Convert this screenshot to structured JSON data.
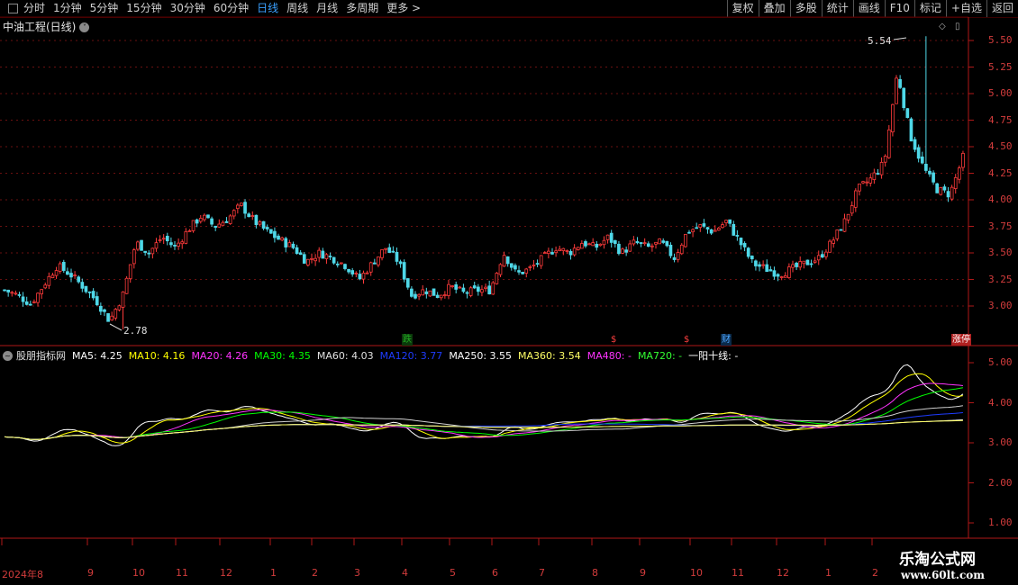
{
  "toolbar": {
    "periods": [
      "分时",
      "1分钟",
      "5分钟",
      "15分钟",
      "30分钟",
      "60分钟",
      "日线",
      "周线",
      "月线",
      "多周期",
      "更多 >"
    ],
    "active": "日线",
    "right_buttons": [
      "复权",
      "叠加",
      "多股",
      "统计",
      "画线",
      "F10",
      "标记",
      "+自选",
      "返回"
    ]
  },
  "main": {
    "title": "中油工程(日线)",
    "price_labels": [
      "5.50",
      "5.25",
      "5.00",
      "4.75",
      "4.50",
      "4.25",
      "4.00",
      "3.75",
      "3.50",
      "3.25",
      "3.00"
    ],
    "high_label": "5.54",
    "low_label": "2.78",
    "events": [
      {
        "text": "跌",
        "color": "#22aa22",
        "bg": "#0b3a0b"
      },
      {
        "text": "$",
        "color": "#ff4040",
        "bg": ""
      },
      {
        "text": "$",
        "color": "#ff4040",
        "bg": ""
      },
      {
        "text": "财",
        "color": "#4da6ff",
        "bg": "#0a2a4a"
      },
      {
        "text": "涨停",
        "color": "#ffffff",
        "bg": "#b02020"
      }
    ]
  },
  "indicator": {
    "circle": "~",
    "name": "股朋指标网",
    "items": [
      {
        "text": "MA5: 4.25",
        "color": "#ffffff"
      },
      {
        "text": "MA10: 4.16",
        "color": "#ffff00"
      },
      {
        "text": "MA20: 4.26",
        "color": "#ff33ff"
      },
      {
        "text": "MA30: 4.35",
        "color": "#00ff00"
      },
      {
        "text": "MA60: 4.03",
        "color": "#e0e0e0"
      },
      {
        "text": "MA120: 3.77",
        "color": "#1e3cff"
      },
      {
        "text": "MA250: 3.55",
        "color": "#ffffff"
      },
      {
        "text": "MA360: 3.54",
        "color": "#ffff66"
      },
      {
        "text": "MA480: -",
        "color": "#ff33ff"
      },
      {
        "text": "MA720: -",
        "color": "#33ff33"
      },
      {
        "text": "一阳十线: -",
        "color": "#ffffff"
      }
    ],
    "labels": [
      "5.00",
      "4.00",
      "3.00",
      "2.00",
      "1.00"
    ]
  },
  "x_axis": [
    "2024年8",
    "9",
    "10",
    "11",
    "12",
    "1",
    "2",
    "3",
    "4",
    "5",
    "6",
    "7",
    "8",
    "9",
    "10",
    "11",
    "12",
    "1",
    "2"
  ],
  "watermark": {
    "title": "乐淘公式网",
    "url": "www.60lt.com"
  },
  "chart_data": {
    "type": "candlestick",
    "title": "中油工程(日线)",
    "price_axis": [
      3.0,
      5.5
    ],
    "x_labels": [
      "2024年8",
      "9",
      "10",
      "11",
      "12",
      "1",
      "2",
      "3",
      "4",
      "5",
      "6",
      "7",
      "8",
      "9",
      "10",
      "11",
      "12",
      "1",
      "2"
    ],
    "high": 5.54,
    "low": 2.78,
    "anchor_closes": [
      3.15,
      3.1,
      3.02,
      3.2,
      3.38,
      3.3,
      3.18,
      3.05,
      2.86,
      3.1,
      3.6,
      3.5,
      3.65,
      3.55,
      3.72,
      3.85,
      3.75,
      3.82,
      3.95,
      3.8,
      3.7,
      3.62,
      3.55,
      3.42,
      3.5,
      3.45,
      3.38,
      3.25,
      3.4,
      3.55,
      3.42,
      3.1,
      3.15,
      3.1,
      3.18,
      3.12,
      3.15,
      3.15,
      3.5,
      3.3,
      3.35,
      3.45,
      3.55,
      3.5,
      3.6,
      3.55,
      3.65,
      3.5,
      3.6,
      3.55,
      3.6,
      3.45,
      3.7,
      3.75,
      3.7,
      3.8,
      3.6,
      3.4,
      3.35,
      3.3,
      3.35,
      3.4,
      3.45,
      3.6,
      3.8,
      4.1,
      4.2,
      4.35,
      5.2,
      4.6,
      4.3,
      4.1,
      4.05,
      4.4
    ],
    "indicator": {
      "axis": [
        1.0,
        5.0
      ],
      "series": [
        {
          "name": "MA5",
          "last": 4.25
        },
        {
          "name": "MA10",
          "last": 4.16
        },
        {
          "name": "MA20",
          "last": 4.26
        },
        {
          "name": "MA30",
          "last": 4.35
        },
        {
          "name": "MA60",
          "last": 4.03
        },
        {
          "name": "MA120",
          "last": 3.77
        },
        {
          "name": "MA250",
          "last": 3.55
        },
        {
          "name": "MA360",
          "last": 3.54
        }
      ]
    }
  }
}
